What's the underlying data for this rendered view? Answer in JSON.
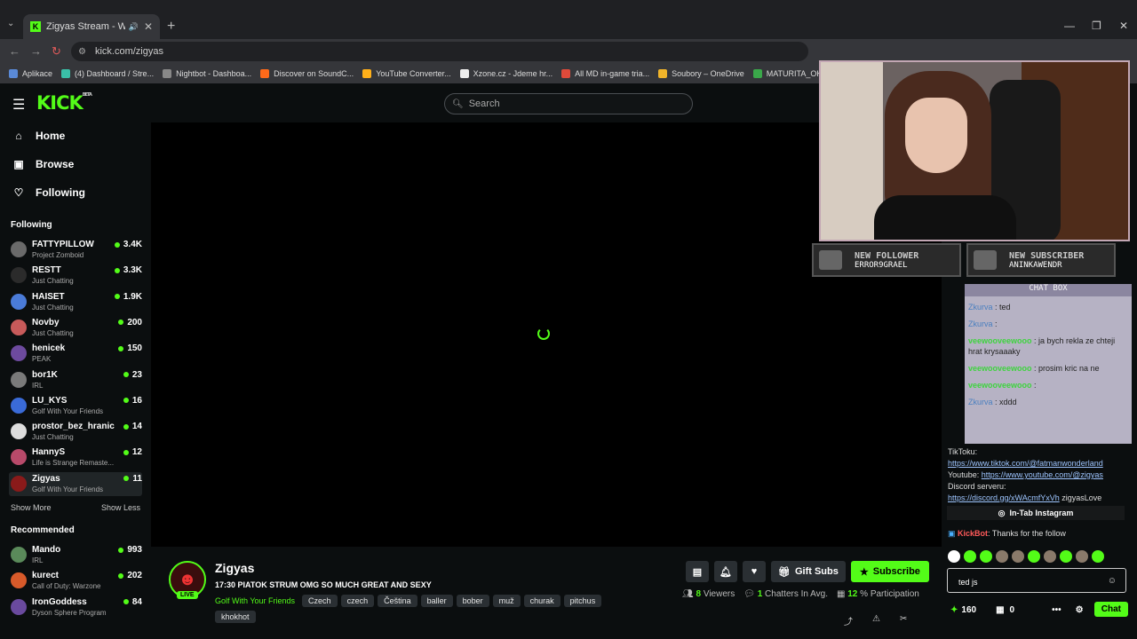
{
  "browser": {
    "tab_title": "Zigyas Stream - Watch Live",
    "url": "kick.com/zigyas",
    "bookmarks": [
      "Aplikace",
      "(4) Dashboard / Stre...",
      "Nightbot - Dashboa...",
      "Discover on SoundC...",
      "YouTube Converter...",
      "Xzone.cz - Jdeme hr...",
      "All MD in-game tria...",
      "Soubory – OneDrive",
      "MATURITA_OKRUH..."
    ]
  },
  "header": {
    "logo": "KICK",
    "logo_badge": "BETA",
    "search_placeholder": "Search"
  },
  "sidebar": {
    "nav": [
      {
        "label": "Home",
        "icon": "home-icon"
      },
      {
        "label": "Browse",
        "icon": "browse-icon"
      },
      {
        "label": "Following",
        "icon": "heart-icon"
      }
    ],
    "following_title": "Following",
    "following": [
      {
        "name": "FATTYPILLOW",
        "category": "Project Zomboid",
        "viewers": "3.4K",
        "color": "#6a6a6a"
      },
      {
        "name": "RESTT",
        "category": "Just Chatting",
        "viewers": "3.3K",
        "color": "#2b2b2b"
      },
      {
        "name": "HAISET",
        "category": "Just Chatting",
        "viewers": "1.9K",
        "color": "#4a7bd8"
      },
      {
        "name": "Novby",
        "category": "Just Chatting",
        "viewers": "200",
        "color": "#c75a5a"
      },
      {
        "name": "henicek",
        "category": "PEAK",
        "viewers": "150",
        "color": "#6d4a9e"
      },
      {
        "name": "bor1K",
        "category": "IRL",
        "viewers": "23",
        "color": "#7a7a7a"
      },
      {
        "name": "LU_KYS",
        "category": "Golf With Your Friends",
        "viewers": "16",
        "color": "#3a6bd8"
      },
      {
        "name": "prostor_bez_hranic",
        "category": "Just Chatting",
        "viewers": "14",
        "color": "#dddddd"
      },
      {
        "name": "HannyS",
        "category": "Life is Strange Remaste...",
        "viewers": "12",
        "color": "#b84a6a"
      },
      {
        "name": "Zigyas",
        "category": "Golf With Your Friends",
        "viewers": "11",
        "color": "#8a1a1a"
      }
    ],
    "show_more": "Show More",
    "show_less": "Show Less",
    "recommended_title": "Recommended",
    "recommended": [
      {
        "name": "Mando",
        "category": "IRL",
        "viewers": "993",
        "color": "#5a8a5a"
      },
      {
        "name": "kurect",
        "category": "Call of Duty: Warzone",
        "viewers": "202",
        "color": "#d85a2a"
      },
      {
        "name": "IronGoddess",
        "category": "Dyson Sphere Program",
        "viewers": "84",
        "color": "#6a4a9e"
      }
    ]
  },
  "stream": {
    "name": "Zigyas",
    "live_label": "LIVE",
    "title": "17:30 PIATOK STRUM OMG SO MUCH GREAT AND SEXY",
    "category": "Golf With Your Friends",
    "tags": [
      "Czech",
      "czech",
      "Čeština",
      "baller",
      "bober",
      "muž",
      "churak",
      "pitchus",
      "khokhot"
    ],
    "gift_label": "Gift Subs",
    "subscribe_label": "Subscribe",
    "viewers_num": "8",
    "viewers_label": "Viewers",
    "chatters_num": "1",
    "chatters_label": "Chatters In Avg.",
    "participation_num": "12",
    "participation_label": "% Participation"
  },
  "overlay": {
    "follower_title": "NEW FOLLOWER",
    "follower_name": "ERROR9GRAEL",
    "subscriber_title": "NEW SUBSCRIBER",
    "subscriber_name": "ANINKAWENDR",
    "chatbox_title": "CHAT BOX",
    "messages": [
      {
        "user": "Zkurva",
        "text": " : ted",
        "style": "u1"
      },
      {
        "user": "Zkurva",
        "text": " : ",
        "style": "u1"
      },
      {
        "user": "veewooveewooo",
        "text": " : ja bych rekla ze chteji hrat krysaaaky",
        "style": "u2"
      },
      {
        "user": "veewooveewooo",
        "text": " : prosim kric na ne",
        "style": "u2"
      },
      {
        "user": "veewooveewooo",
        "text": " : ",
        "style": "u2"
      },
      {
        "user": "Zkurva",
        "text": " : xddd",
        "style": "u1"
      }
    ]
  },
  "chat": {
    "about_lines": [
      {
        "label": "Youtube:",
        "text": ""
      },
      {
        "label": "TikToku:",
        "text": ""
      }
    ],
    "tiktok_label": "TikToku:",
    "tiktok_link": "https://www.tiktok.com/@fatmanwonderland",
    "youtube_label": "Youtube:",
    "youtube_link": "https://www.youtube.com/@zigyas",
    "discord_label": "Discord serveru:",
    "discord_link": "https://discord.gg/xWAcmfYxVh",
    "discord_suffix": " zigyasLove",
    "intab": "In-Tab Instagram",
    "kickbot_name": "KickBot",
    "kickbot_msg": ": Thanks for the follow",
    "input_value": "ted js",
    "points": "160",
    "other_count": "0",
    "chat_button": "Chat"
  }
}
